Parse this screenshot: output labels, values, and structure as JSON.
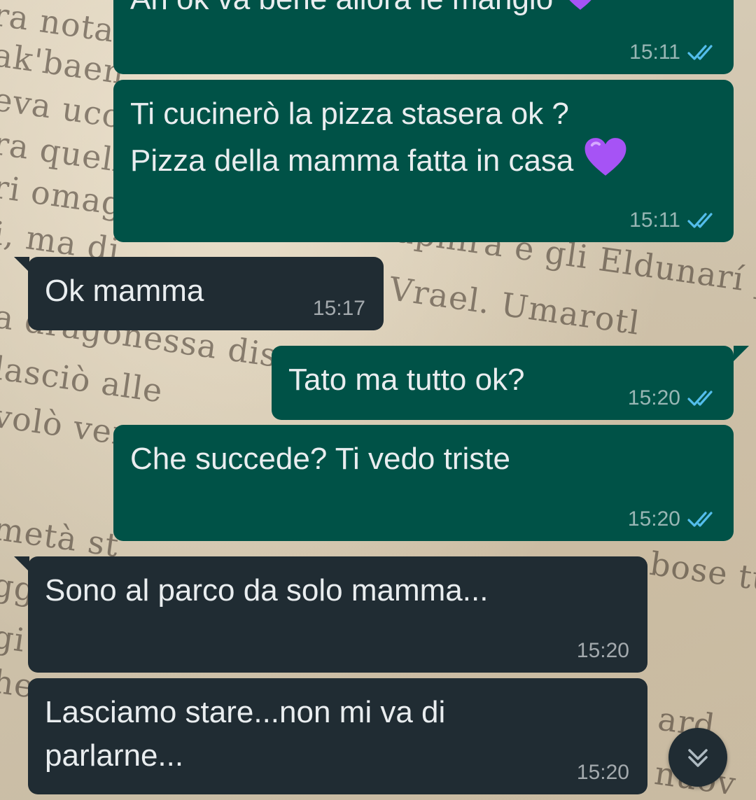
{
  "chat": {
    "messages": [
      {
        "direction": "out",
        "text": "Ah ok va bene allora le mangio",
        "emoji": "heart-purple",
        "time": "15:11",
        "status": "read"
      },
      {
        "direction": "out",
        "line1": "Ti cucinerò la pizza stasera ok ?",
        "line2": "Pizza della mamma fatta in casa",
        "emoji": "heart-purple",
        "time": "15:11",
        "status": "read"
      },
      {
        "direction": "in",
        "text": "Ok mamma",
        "time": "15:17"
      },
      {
        "direction": "out",
        "text": "Tato ma tutto ok?",
        "time": "15:20",
        "status": "read"
      },
      {
        "direction": "out",
        "text": "Che succede? Ti vedo triste",
        "time": "15:20",
        "status": "read"
      },
      {
        "direction": "in",
        "text": "Sono al parco da solo mamma...",
        "time": "15:20"
      },
      {
        "direction": "in",
        "line1": "Lasciamo stare...non mi va di",
        "line2": "parlarne...",
        "time": "15:20"
      }
    ]
  },
  "wallpaper": {
    "lines": [
      "ra nota",
      "ak'baen,",
      "eva ucci",
      "ra quell",
      "ri omag",
      "i, ma di",
      "Saphira e gli Eldunarí po",
      "Vrael. Umarotl",
      "a dragonessa disp",
      "lasciò alle",
      "volò ver",
      "metà st",
      "bose tu",
      "gg",
      "gi",
      "he",
      "ard",
      "nuov"
    ]
  },
  "scroll_button": {
    "icon": "double-chevron-down-icon"
  },
  "colors": {
    "outgoing_bubble": "#005247",
    "incoming_bubble": "#202c33",
    "read_ticks": "#53bdeb",
    "text": "#e9edef"
  }
}
